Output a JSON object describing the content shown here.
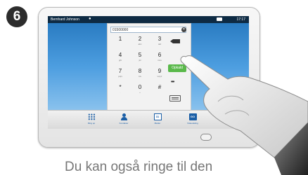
{
  "step": {
    "number": "6"
  },
  "status_bar": {
    "user": "Bernhard Johnson",
    "time": "17:17"
  },
  "dialer": {
    "input_value": "01500000",
    "keys": [
      {
        "digit": "1",
        "letters": ""
      },
      {
        "digit": "2",
        "letters": "abc"
      },
      {
        "digit": "3",
        "letters": "def"
      },
      {
        "digit": "4",
        "letters": "ghi"
      },
      {
        "digit": "5",
        "letters": "jkl"
      },
      {
        "digit": "6",
        "letters": "mno"
      },
      {
        "digit": "7",
        "letters": "pqrs"
      },
      {
        "digit": "8",
        "letters": "tuv"
      },
      {
        "digit": "9",
        "letters": "wxyz"
      },
      {
        "digit": "*",
        "letters": "."
      },
      {
        "digit": "0",
        "letters": "+"
      },
      {
        "digit": "#",
        "letters": ""
      }
    ],
    "call_label": "Opkald",
    "more_label": "•••"
  },
  "taskbar": {
    "items": [
      {
        "label": "Ring op",
        "icon": "grid-icon"
      },
      {
        "label": "Kontakter",
        "icon": "person-icon"
      },
      {
        "label": "Møder",
        "icon": "calendar-icon"
      },
      {
        "label": "Videodeling",
        "icon": "share-icon"
      },
      {
        "label": "",
        "icon": "upload-icon"
      }
    ],
    "calendar_digit": "31",
    "share_text": "GO"
  },
  "caption": "Du kan også ringe til den",
  "colors": {
    "call_green": "#5ab94b",
    "screen_blue": "#2476bd"
  }
}
